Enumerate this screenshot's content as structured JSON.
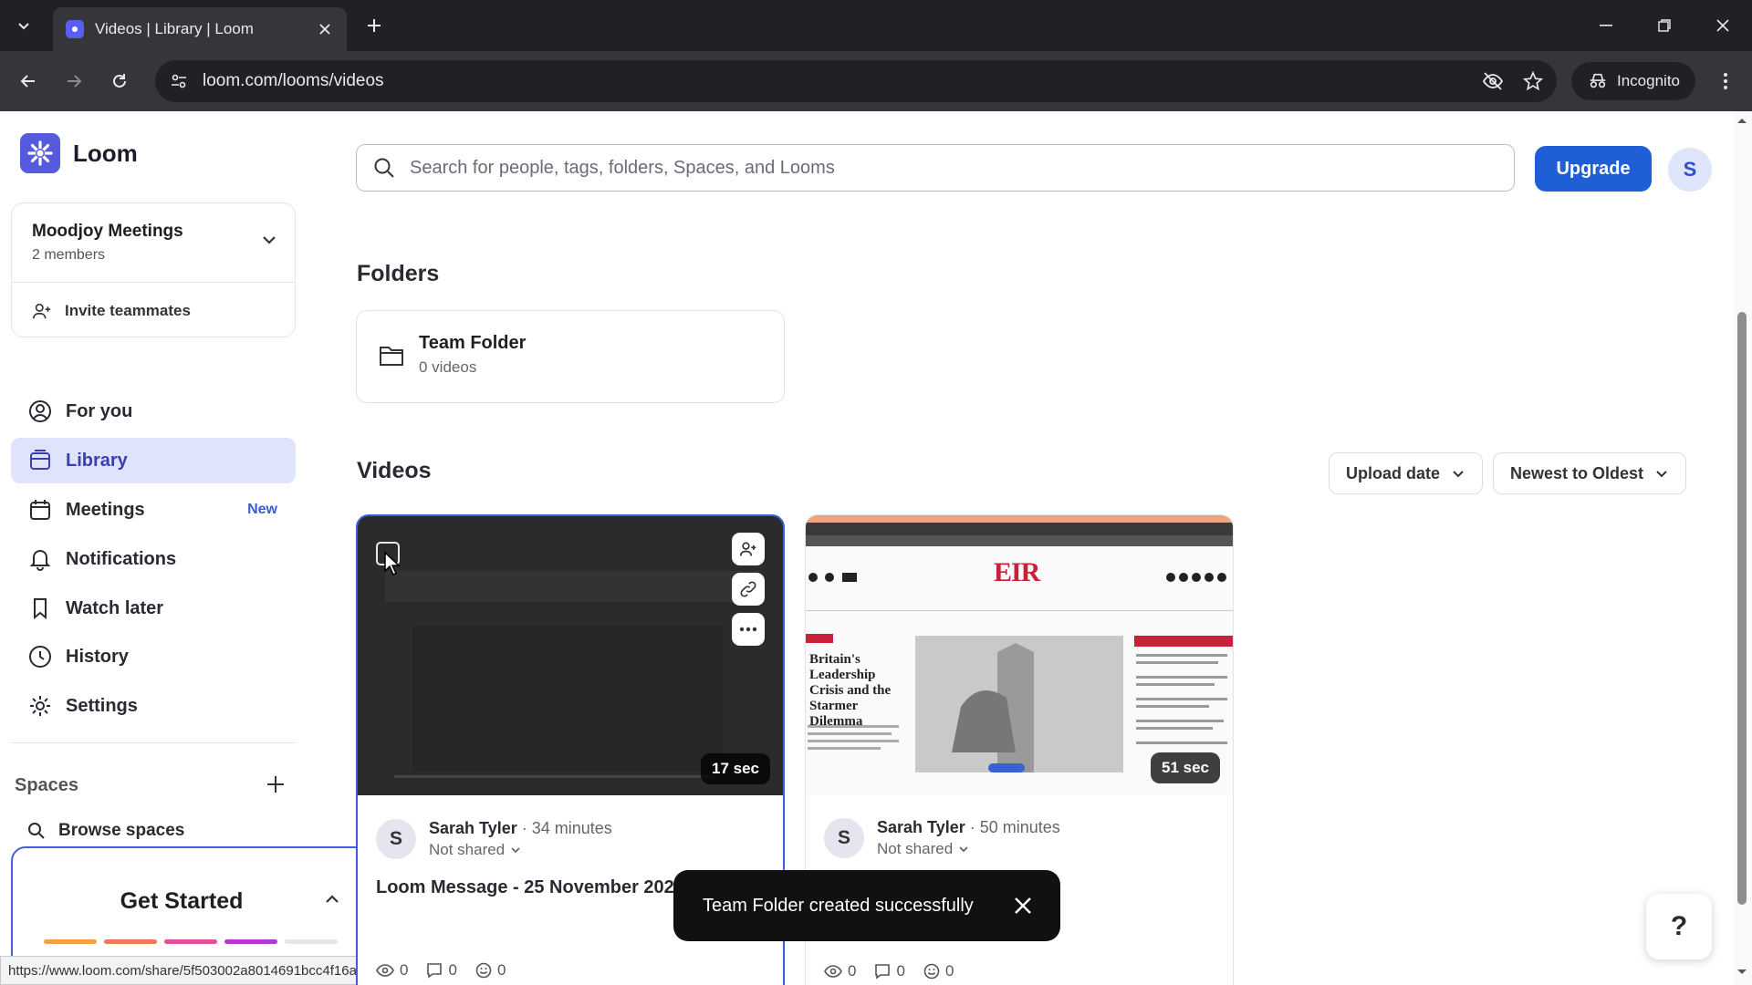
{
  "browser": {
    "tab_title": "Videos | Library | Loom",
    "url": "loom.com/looms/videos",
    "incognito_label": "Incognito",
    "status_url": "https://www.loom.com/share/5f503002a8014691bcc4f16ab7492509"
  },
  "app": {
    "name": "Loom",
    "brand_color": "#565add",
    "accent_color": "#1f5fd6"
  },
  "workspace": {
    "name": "Moodjoy Meetings",
    "members": "2 members",
    "invite_label": "Invite teammates"
  },
  "nav": {
    "for_you": "For you",
    "library": "Library",
    "meetings": "Meetings",
    "meetings_badge": "New",
    "notifications": "Notifications",
    "watch_later": "Watch later",
    "history": "History",
    "settings": "Settings"
  },
  "spaces": {
    "heading": "Spaces",
    "browse": "Browse spaces"
  },
  "get_started": {
    "title": "Get Started",
    "progress_colors": [
      "#f0a24a",
      "#ec7a5a",
      "#e0509a",
      "#b03cc8",
      "#e6e6e6"
    ]
  },
  "search": {
    "placeholder": "Search for people, tags, folders, Spaces, and Looms"
  },
  "header": {
    "upgrade_label": "Upgrade",
    "avatar_initial": "S"
  },
  "folders": {
    "heading": "Folders",
    "items": [
      {
        "name": "Team Folder",
        "count": "0 videos"
      }
    ]
  },
  "videos": {
    "heading": "Videos",
    "sort_field": "Upload date",
    "sort_order": "Newest to Oldest",
    "items": [
      {
        "author": "Sarah Tyler",
        "initial": "S",
        "age": "34 minutes",
        "sharing": "Not shared",
        "title": "Loom Message - 25 November 202",
        "duration": "17 sec",
        "views": "0",
        "comments": "0",
        "reactions": "0"
      },
      {
        "author": "Sarah Tyler",
        "initial": "S",
        "age": "50 minutes",
        "sharing": "Not shared",
        "title": "",
        "duration": "51 sec",
        "views": "0",
        "comments": "0",
        "reactions": "0",
        "thumb_headline": "Britain's Leadership Crisis and the Starmer Dilemma",
        "thumb_logo": "EIR"
      }
    ]
  },
  "toast": {
    "message": "Team Folder created successfully"
  },
  "help": {
    "label": "?"
  }
}
